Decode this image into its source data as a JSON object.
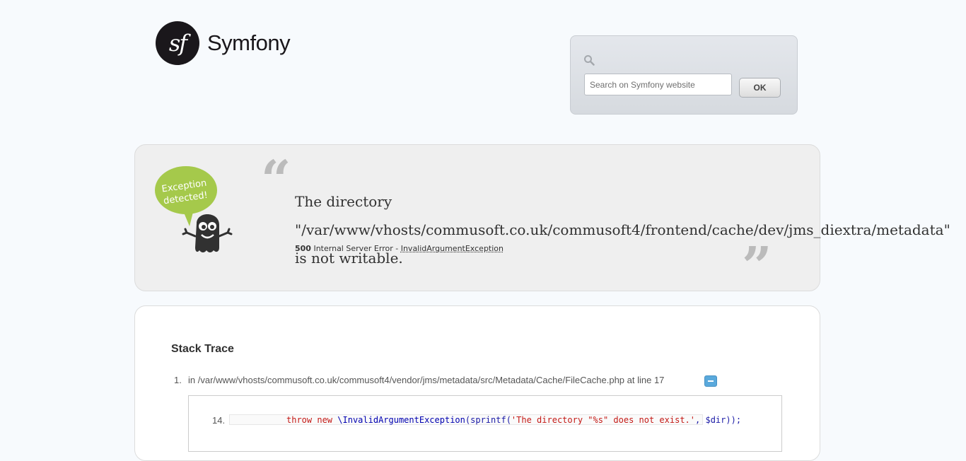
{
  "header": {
    "logo_mark": "sf",
    "logo_text": "Symfony"
  },
  "search": {
    "placeholder": "Search on Symfony website",
    "ok_label": "OK",
    "icon": "search-icon"
  },
  "exception": {
    "mascot_text": "Exception detected!",
    "message": "The directory \"/var/www/vhosts/commusoft.co.uk/commusoft4/frontend/cache/dev/jms_diextra/metadata\" is not writable.",
    "status_code": "500",
    "status_text": "Internal Server Error -",
    "exception_class": "InvalidArgumentException"
  },
  "trace": {
    "title": "Stack Trace",
    "items": [
      {
        "number": "1.",
        "location": "in /var/www/vhosts/commusoft.co.uk/commusoft4/vendor/jms/metadata/src/Metadata/Cache/FileCache.php at line 17",
        "code_line_number": "14.",
        "code": {
          "kw": "throw new",
          "cls": "\\InvalidArgumentException",
          "fn_open": "(sprintf(",
          "str": "'The directory \"%s\" does not exist.'",
          "rest": ", $dir));"
        }
      }
    ]
  },
  "colors": {
    "page_bg": "#f7fafd",
    "toggle": "#5aa9dc",
    "mascot_bubble": "#a5c94b"
  }
}
